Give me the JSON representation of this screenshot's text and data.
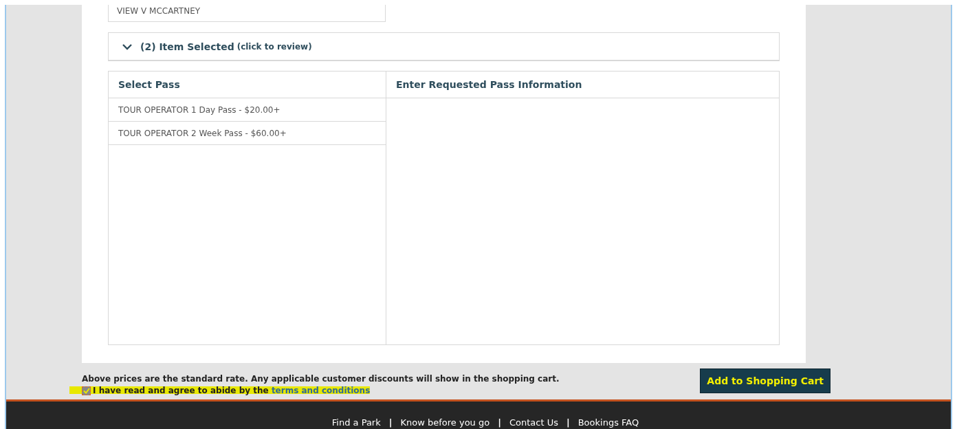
{
  "selected_customer": "VIEW V MCCARTNEY",
  "review_bar": {
    "expanded": true,
    "count_label": "(2) Item Selected",
    "hint": "(click to review)"
  },
  "table": {
    "columns": [
      "Select Pass",
      "Enter Requested Pass Information"
    ],
    "passes": [
      {
        "label": "TOUR OPERATOR 1 Day Pass - $20.00+"
      },
      {
        "label": "TOUR OPERATOR 2 Week Pass - $60.00+"
      }
    ]
  },
  "price_note": "Above prices are the standard rate. Any applicable customer discounts will show in the shopping cart.",
  "agreement": {
    "checked": true,
    "text": "I have read and agree to abide by the",
    "link": "terms and conditions"
  },
  "add_button": "Add to Shopping Cart",
  "footer_items": [
    {
      "kind": "link",
      "text": "Find a Park"
    },
    {
      "kind": "separator",
      "text": "|"
    },
    {
      "kind": "link",
      "text": "Know before you go"
    },
    {
      "kind": "separator",
      "text": "|"
    },
    {
      "kind": "link",
      "text": "Contact Us"
    },
    {
      "kind": "separator",
      "text": "|"
    },
    {
      "kind": "link",
      "text": "Bookings FAQ"
    }
  ]
}
